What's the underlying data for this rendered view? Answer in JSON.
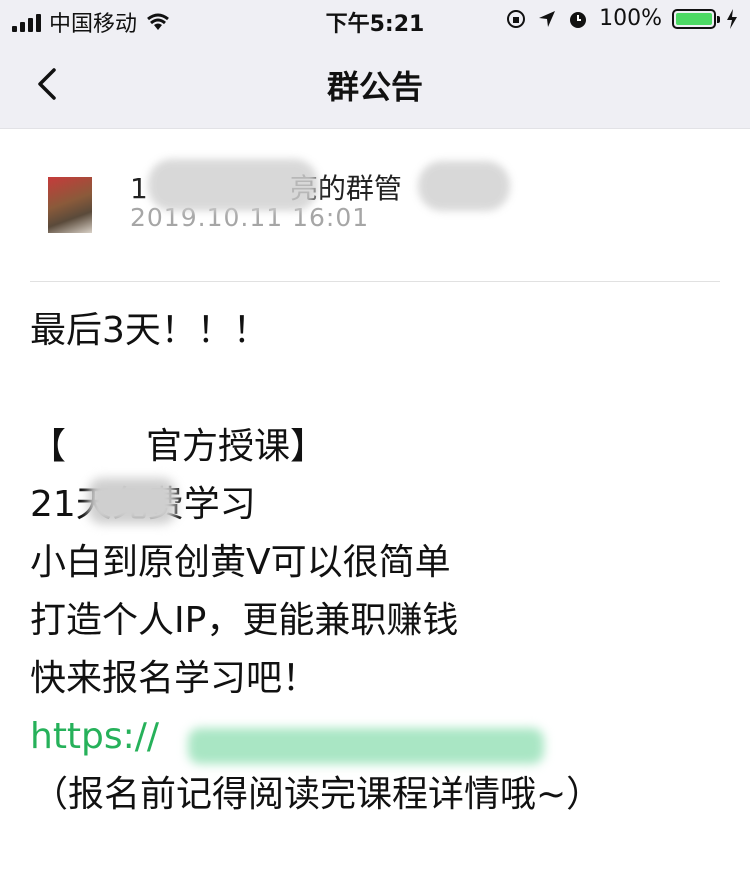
{
  "status_bar": {
    "carrier": "中国移动",
    "time": "下午5:21",
    "battery_percent": "100%",
    "battery_level": 1.0,
    "icons": [
      "signal-icon",
      "wifi-icon",
      "orientation-lock-icon",
      "location-icon",
      "alarm-icon",
      "battery-icon",
      "charging-icon"
    ]
  },
  "nav": {
    "title": "群公告",
    "back_icon": "chevron-left-icon"
  },
  "author": {
    "name_visible": "亮的群管",
    "name_prefix": "1",
    "time": "2019.10.11 16:01"
  },
  "content": {
    "lines": [
      "最后3天！！！",
      "",
      "【",
      "21天免费学习",
      "小白到原创黄V可以很简单",
      "打造个人IP，更能兼职赚钱",
      "快来报名学习吧！",
      "https://",
      "（报名前记得阅读完课程详情哦~）"
    ],
    "bracket_text": "官方授课】",
    "link_color": "#26b15a"
  },
  "colors": {
    "nav_bg": "#efeff4",
    "link": "#26b15a",
    "battery": "#4cd964"
  }
}
